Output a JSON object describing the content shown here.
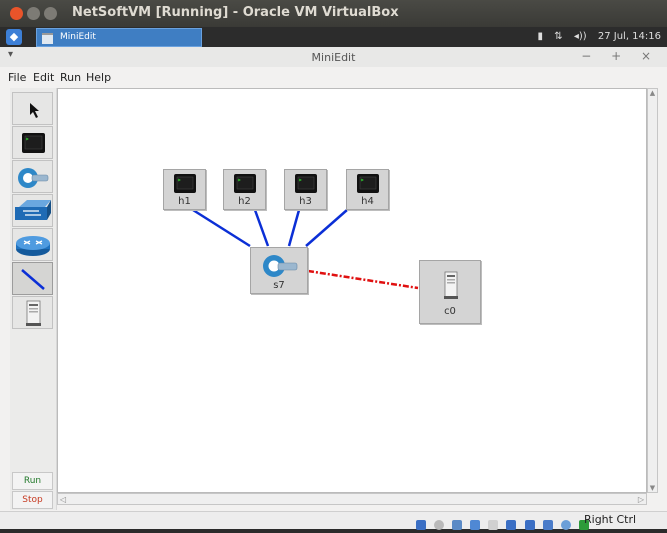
{
  "vbox": {
    "title": "NetSoftVM [Running] - Oracle VM VirtualBox"
  },
  "taskbar": {
    "task_label": "MiniEdit",
    "battery": "",
    "network": "⇅",
    "volume": "◂))",
    "clock": "27 Jul, 14:16"
  },
  "window": {
    "title": "MiniEdit",
    "controls": "− + ×"
  },
  "menu": {
    "file": "File",
    "edit": "Edit",
    "run": "Run",
    "help": "Help"
  },
  "toolbox": {
    "tools": [
      {
        "name": "select-tool",
        "icon": "arrow-cursor-icon"
      },
      {
        "name": "host-tool",
        "icon": "host-terminal-icon"
      },
      {
        "name": "switch-tool",
        "icon": "ovs-switch-icon"
      },
      {
        "name": "legacy-switch-tool",
        "icon": "legacy-switch-icon"
      },
      {
        "name": "router-tool",
        "icon": "router-icon"
      },
      {
        "name": "link-tool",
        "icon": "link-icon",
        "selected": true
      },
      {
        "name": "controller-tool",
        "icon": "controller-server-icon"
      }
    ],
    "run_label": "Run",
    "stop_label": "Stop"
  },
  "canvas": {
    "hosts": [
      {
        "label": "h1"
      },
      {
        "label": "h2"
      },
      {
        "label": "h3"
      },
      {
        "label": "h4"
      }
    ],
    "switch": {
      "label": "s7"
    },
    "controller": {
      "label": "c0"
    }
  },
  "colors": {
    "data_link": "#0b2fd6",
    "control_link": "#e01010",
    "accent": "#3f7ec3"
  },
  "statusbar": {
    "host_key": "Right Ctrl"
  }
}
